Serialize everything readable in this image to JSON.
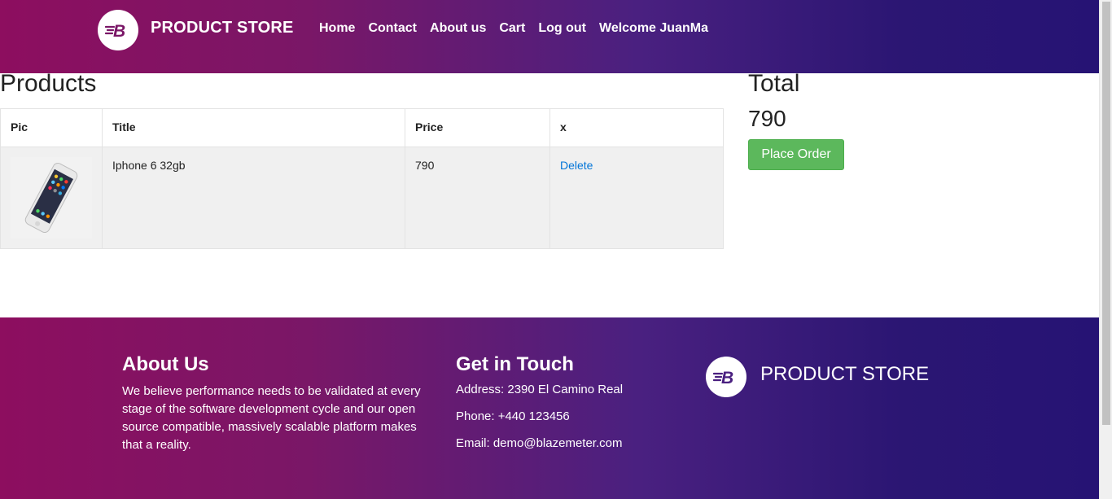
{
  "header": {
    "brand": "PRODUCT STORE",
    "nav": [
      "Home",
      "Contact",
      "About us",
      "Cart",
      "Log out",
      "Welcome JuanMa"
    ]
  },
  "products": {
    "title": "Products",
    "columns": [
      "Pic",
      "Title",
      "Price",
      "x"
    ],
    "rows": [
      {
        "title": "Iphone 6 32gb",
        "price": "790",
        "action": "Delete"
      }
    ]
  },
  "total": {
    "title": "Total",
    "value": "790",
    "button": "Place Order"
  },
  "footer": {
    "about_heading": "About Us",
    "about_text": "We believe performance needs to be validated at every stage of the software development cycle and our open source compatible, massively scalable platform makes that a reality.",
    "contact_heading": "Get in Touch",
    "address": "Address: 2390 El Camino Real",
    "phone": "Phone: +440 123456",
    "email": "Email: demo@blazemeter.com",
    "brand": "PRODUCT STORE"
  },
  "colors": {
    "gradient_start": "#8d0e5f",
    "gradient_end": "#261374",
    "success": "#5cb85c",
    "link": "#0275d8"
  }
}
